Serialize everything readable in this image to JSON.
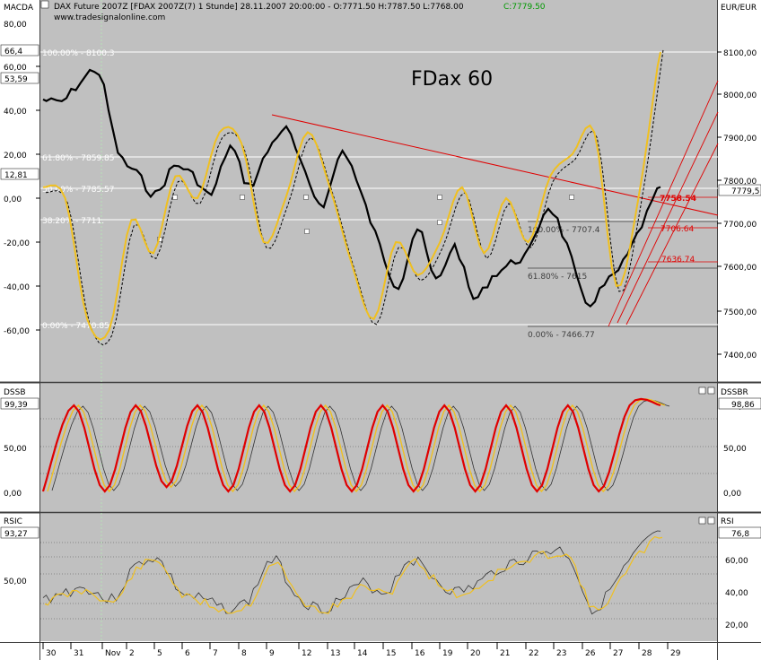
{
  "header": {
    "text": "DAX Future 2007Z [FDAX 2007Z(7)  1 Stunde] 28.11.2007 20:00:00 - O:7771.50 H:7787.50 L:7768.00",
    "close_text": "C:7779.50",
    "website": "www.tradesignalonline.com",
    "watermark": "FDax 60"
  },
  "colors": {
    "background": "#c0c0c0",
    "price": "#000000",
    "yellow": "#f0c020",
    "red": "#e00000",
    "trendline": "#e00000",
    "axis_bg": "#ffffff",
    "accent_green": "#009900"
  },
  "panels": {
    "macd": {
      "left_label": "MACDA",
      "right_label": "EUR/EUR",
      "left_value": "66,4",
      "left_value2": "53,59",
      "left_value3": "12,81",
      "right_value": "7779,5",
      "left_ticks": [
        "80,00",
        "60,00",
        "40,00",
        "20,00",
        "0,00",
        "-20,00",
        "-40,00",
        "-60,00"
      ],
      "right_ticks": [
        "8100,00",
        "8000,00",
        "7900,00",
        "7800,00",
        "7700,00",
        "7600,00",
        "7500,00",
        "7400,00"
      ]
    },
    "dssb": {
      "left_label": "DSSB",
      "right_label": "DSSBR",
      "left_value": "99,39",
      "right_value": "98,86",
      "left_ticks": [
        "100,00",
        "50,00",
        "0,00"
      ],
      "right_ticks": [
        "100,00",
        "50,00",
        "0,00"
      ]
    },
    "rsi": {
      "left_label": "RSIC",
      "right_label": "RSI",
      "left_value": "93,27",
      "right_value": "76,8",
      "left_ticks": [
        "50,00"
      ],
      "right_ticks": [
        "60,00",
        "40,00",
        "20,00"
      ]
    }
  },
  "fib_left": {
    "level_100": "100.00% - 8100.3",
    "level_618": "61.80% - 7859.85",
    "level_50": "50.00% - 7785.57",
    "level_382": "38.20% - 7711.",
    "level_0": "0.00% - 7470.85"
  },
  "fib_right": {
    "level_100": "100.00% - 7707.4",
    "level_618": "61.80% - 7615",
    "level_0": "0.00% - 7466.77"
  },
  "price_labels": {
    "p1": "7758.54",
    "p2": "7706.64",
    "p3": "7636.74"
  },
  "x_axis": [
    "30",
    "31",
    "Nov",
    "2",
    "5",
    "6",
    "7",
    "8",
    "9",
    "12",
    "13",
    "14",
    "15",
    "16",
    "19",
    "20",
    "21",
    "22",
    "23",
    "26",
    "27",
    "28",
    "29"
  ],
  "chart_data": {
    "type": "line",
    "title": "DAX Future 2007Z [FDAX 2007Z(7)  1 Stunde]",
    "series": [
      {
        "values": [
          7990,
          7985,
          8030,
          8050,
          7870,
          7820,
          7770,
          7835,
          7815,
          7770,
          7880,
          7790,
          7870,
          7920,
          7815,
          7750,
          7870,
          7770,
          7650,
          7560,
          7690,
          7570,
          7650,
          7530,
          7580,
          7610,
          7640,
          7740,
          7650,
          7520,
          7560,
          7610,
          7700,
          7790
        ]
      },
      {
        "values": [
          5,
          0,
          -55,
          -60,
          -10,
          -25,
          10,
          0,
          30,
          25,
          -20,
          0,
          30,
          5,
          -30,
          -55,
          -20,
          -35,
          -20,
          5,
          -25,
          0,
          -20,
          10,
          20,
          30,
          -40,
          0,
          70
        ]
      },
      {
        "values": [
          0,
          100,
          0,
          100,
          5,
          100,
          0,
          100,
          0,
          100,
          0,
          100,
          0,
          100,
          0,
          100,
          0,
          100,
          0,
          100,
          100
        ]
      },
      {
        "values": [
          35,
          40,
          42,
          35,
          55,
          60,
          40,
          35,
          30,
          35,
          60,
          40,
          30,
          35,
          45,
          40,
          60,
          50,
          40,
          45,
          55,
          60,
          65,
          62,
          30,
          45,
          65,
          77
        ]
      }
    ],
    "price_ylim": [
      7350,
      8150
    ],
    "macd_ylim": [
      -80,
      90
    ]
  }
}
